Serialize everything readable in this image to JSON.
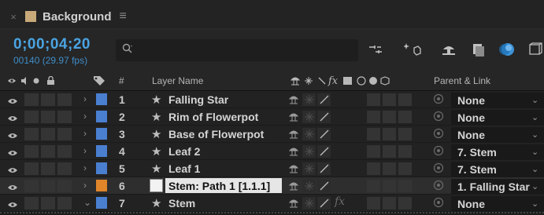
{
  "panel": {
    "close_glyph": "×",
    "title": "Background",
    "menu_glyph": "≡",
    "label_color": "#c8a97a"
  },
  "toolbar": {
    "timecode": "0;00;04;20",
    "frame_rate": "00140 (29.97 fps)",
    "search_icon": "search-icon",
    "icons": [
      "graph-editor-icon",
      "draft-3d-icon",
      "shy-layers-icon",
      "frame-blending-icon",
      "motion-blur-icon",
      "comp-mini-flowchart-icon"
    ]
  },
  "header": {
    "hash": "#",
    "layer_name": "Layer Name",
    "parent_link": "Parent & Link"
  },
  "layers": [
    {
      "num": "1",
      "name": "Falling Star",
      "label_color": "#4a7fd0",
      "parent": "None",
      "fx": false
    },
    {
      "num": "2",
      "name": "Rim of Flowerpot",
      "label_color": "#4a7fd0",
      "parent": "None",
      "fx": false
    },
    {
      "num": "3",
      "name": "Base of Flowerpot",
      "label_color": "#4a7fd0",
      "parent": "None",
      "fx": false
    },
    {
      "num": "4",
      "name": "Leaf 2",
      "label_color": "#4a7fd0",
      "parent": "7. Stem",
      "fx": false
    },
    {
      "num": "5",
      "name": "Leaf 1",
      "label_color": "#4a7fd0",
      "parent": "7. Stem",
      "fx": false
    },
    {
      "num": "6",
      "name": "Stem: Path 1 [1.1.1]",
      "label_color": "#e0852a",
      "parent": "1. Falling Star",
      "fx": false
    },
    {
      "num": "7",
      "name": "Stem",
      "label_color": "#4a7fd0",
      "parent": "None",
      "fx": true
    }
  ],
  "accent": "#4aa3e2"
}
